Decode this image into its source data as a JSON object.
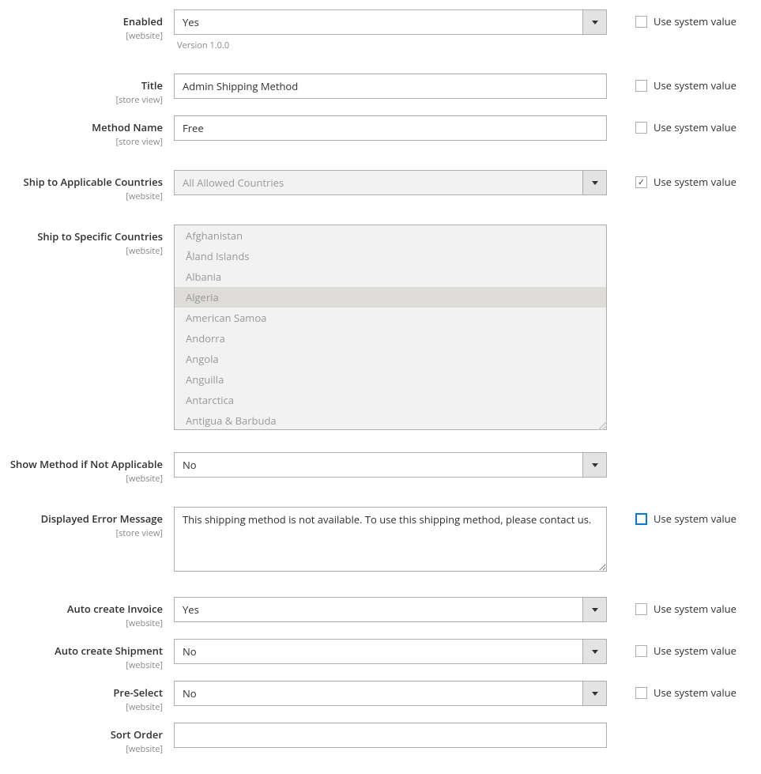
{
  "checkbox_label": "Use system value",
  "fields": {
    "enabled": {
      "label": "Enabled",
      "scope": "[website]",
      "value": "Yes",
      "note": "Version 1.0.0"
    },
    "title": {
      "label": "Title",
      "scope": "[store view]",
      "value": "Admin Shipping Method"
    },
    "method_name": {
      "label": "Method Name",
      "scope": "[store view]",
      "value": "Free"
    },
    "ship_applicable": {
      "label": "Ship to Applicable Countries",
      "scope": "[website]",
      "value": "All Allowed Countries"
    },
    "ship_specific": {
      "label": "Ship to Specific Countries",
      "scope": "[website]"
    },
    "show_method": {
      "label": "Show Method if Not Applicable",
      "scope": "[website]",
      "value": "No"
    },
    "error_msg": {
      "label": "Displayed Error Message",
      "scope": "[store view]",
      "value": "This shipping method is not available. To use this shipping method, please contact us."
    },
    "auto_invoice": {
      "label": "Auto create Invoice",
      "scope": "[website]",
      "value": "Yes"
    },
    "auto_shipment": {
      "label": "Auto create Shipment",
      "scope": "[website]",
      "value": "No"
    },
    "preselect": {
      "label": "Pre-Select",
      "scope": "[website]",
      "value": "No"
    },
    "sort_order": {
      "label": "Sort Order",
      "scope": "[website]",
      "value": ""
    }
  },
  "countries": [
    "Afghanistan",
    "Åland Islands",
    "Albania",
    "Algeria",
    "American Samoa",
    "Andorra",
    "Angola",
    "Anguilla",
    "Antarctica",
    "Antigua & Barbuda"
  ],
  "countries_highlighted": "Algeria"
}
